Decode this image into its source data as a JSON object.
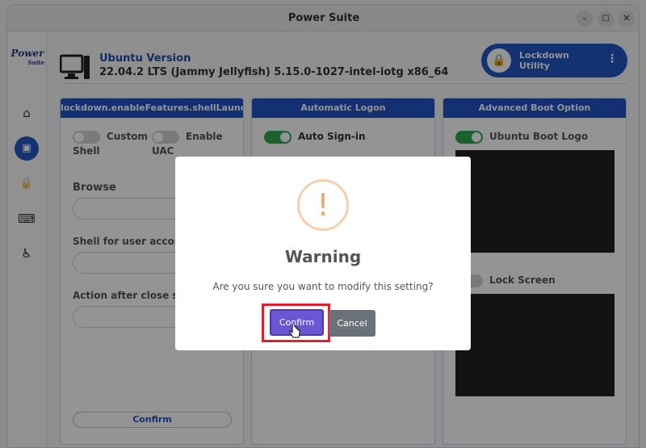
{
  "window": {
    "title": "Power Suite",
    "controls": {
      "minimize": "–",
      "maximize": "□",
      "close": "✕"
    }
  },
  "logo": {
    "main": "Power",
    "sub": "Suite"
  },
  "sidebar": {
    "items": [
      {
        "name": "home-icon",
        "glyph": "⌂"
      },
      {
        "name": "user-badge-icon",
        "glyph": "▣",
        "active": true
      },
      {
        "name": "lock-icon",
        "glyph": "🔒"
      },
      {
        "name": "keyboard-icon",
        "glyph": "⌨"
      },
      {
        "name": "accessibility-icon",
        "glyph": "♿"
      }
    ]
  },
  "header": {
    "version_title": "Ubuntu Version",
    "version_text": "22.04.2 LTS (Jammy Jellyfish) 5.15.0-1027-intel-iotg x86_64",
    "utility": {
      "line1": "Lockdown",
      "line2": "Utility",
      "menu": "⋮"
    }
  },
  "cards": {
    "shell": {
      "header": "lockdown.enableFeatures.shellLauncher",
      "toggle1_label": "Custom",
      "toggle1_sub": "Shell",
      "toggle2_label": "Enable",
      "toggle2_sub": "UAC",
      "browse_label": "Browse",
      "shell_user_label": "Shell for user account",
      "action_label": "Action after close shell",
      "confirm_label": "Confirm"
    },
    "logon": {
      "header": "Automatic Logon",
      "toggle_label": "Auto Sign-in"
    },
    "boot": {
      "header": "Advanced Boot Option",
      "boot_logo_label": "Ubuntu Boot Logo",
      "lock_screen_label": "Lock Screen"
    }
  },
  "dialog": {
    "icon": "!",
    "title": "Warning",
    "message": "Are you sure you want to modify this setting?",
    "confirm": "Confirm",
    "cancel": "Cancel"
  },
  "colors": {
    "accent": "#2155c5",
    "confirm_button": "#6b57d6",
    "cancel_button": "#6b7178",
    "highlight": "#e11e2d",
    "toggle_on": "#2fa84f"
  }
}
